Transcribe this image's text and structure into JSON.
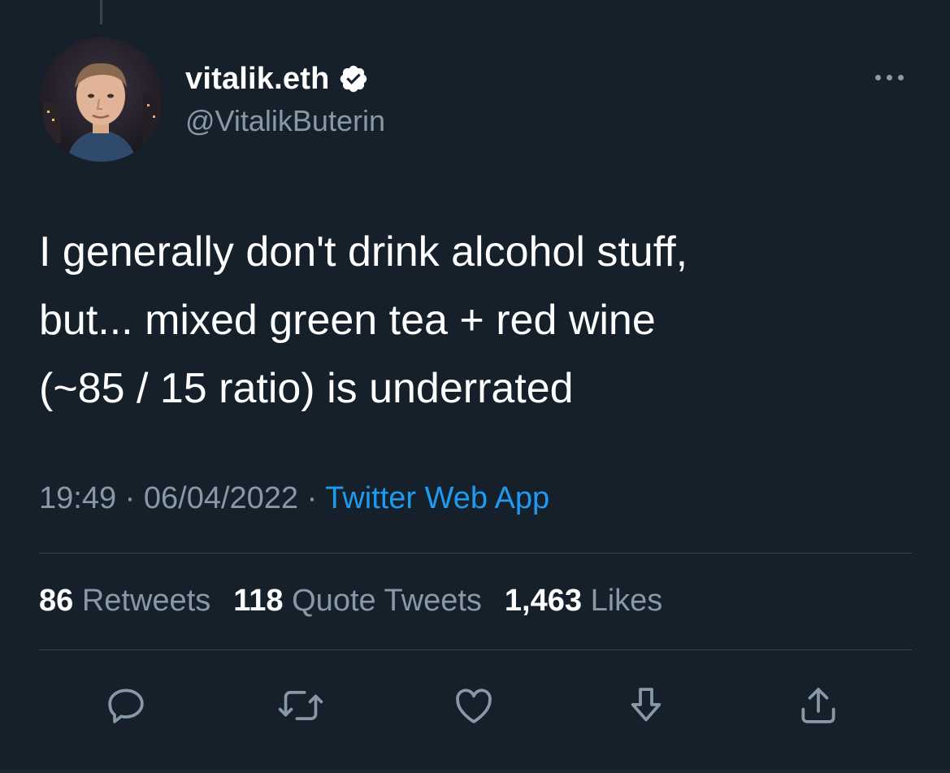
{
  "author": {
    "name": "vitalik.eth",
    "handle": "@VitalikButerin",
    "verified": true
  },
  "tweet": {
    "lines": [
      "I generally don't drink alcohol stuff,",
      "but... mixed green tea + red wine",
      "(~85 / 15 ratio) is underrated"
    ],
    "time": "19:49",
    "separator": " · ",
    "date": "06/04/2022",
    "source": "Twitter Web App"
  },
  "stats": [
    {
      "count": "86",
      "label": "Retweets"
    },
    {
      "count": "118",
      "label": "Quote Tweets"
    },
    {
      "count": "1,463",
      "label": "Likes"
    }
  ],
  "icons": {
    "more": "more-icon",
    "reply": "reply-icon",
    "retweet": "retweet-icon",
    "like": "heart-icon",
    "bookmark": "bookmark-download-icon",
    "share": "share-icon",
    "verified": "verified-badge-icon"
  },
  "colors": {
    "background": "#15202b",
    "text": "#ffffff",
    "secondary": "#8899a6",
    "link": "#1d9bf0",
    "divider": "#38444d"
  }
}
